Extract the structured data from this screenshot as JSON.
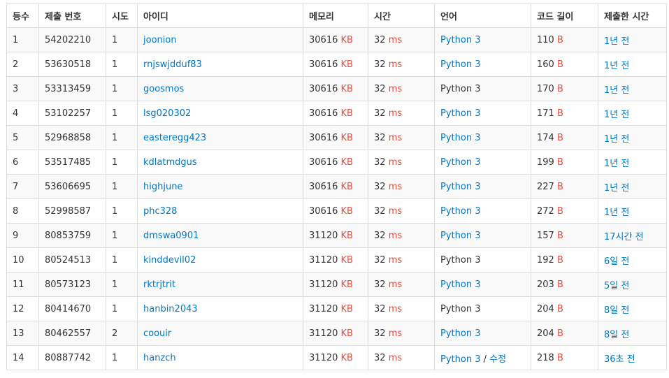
{
  "headers": [
    "등수",
    "제출 번호",
    "시도",
    "아이디",
    "메모리",
    "시간",
    "언어",
    "코드 길이",
    "제출한 시간"
  ],
  "units": {
    "memory": "KB",
    "time": "ms",
    "length": "B"
  },
  "rows": [
    {
      "rank": "1",
      "submit_id": "54202210",
      "tries": "1",
      "user": "joonion",
      "memory": "30616",
      "time": "32",
      "lang": "Python 3",
      "lang_linked": true,
      "edit": "",
      "length": "110",
      "submitted": "1년 전"
    },
    {
      "rank": "2",
      "submit_id": "53630518",
      "tries": "1",
      "user": "rnjswjdduf83",
      "memory": "30616",
      "time": "32",
      "lang": "Python 3",
      "lang_linked": true,
      "edit": "",
      "length": "160",
      "submitted": "1년 전"
    },
    {
      "rank": "3",
      "submit_id": "53313459",
      "tries": "1",
      "user": "goosmos",
      "memory": "30616",
      "time": "32",
      "lang": "Python 3",
      "lang_linked": false,
      "edit": "",
      "length": "170",
      "submitted": "1년 전"
    },
    {
      "rank": "4",
      "submit_id": "53102257",
      "tries": "1",
      "user": "lsg020302",
      "memory": "30616",
      "time": "32",
      "lang": "Python 3",
      "lang_linked": true,
      "edit": "",
      "length": "171",
      "submitted": "1년 전"
    },
    {
      "rank": "5",
      "submit_id": "52968858",
      "tries": "1",
      "user": "easteregg423",
      "memory": "30616",
      "time": "32",
      "lang": "Python 3",
      "lang_linked": true,
      "edit": "",
      "length": "174",
      "submitted": "1년 전"
    },
    {
      "rank": "6",
      "submit_id": "53517485",
      "tries": "1",
      "user": "kdlatmdgus",
      "memory": "30616",
      "time": "32",
      "lang": "Python 3",
      "lang_linked": true,
      "edit": "",
      "length": "199",
      "submitted": "1년 전"
    },
    {
      "rank": "7",
      "submit_id": "53606695",
      "tries": "1",
      "user": "highjune",
      "memory": "30616",
      "time": "32",
      "lang": "Python 3",
      "lang_linked": true,
      "edit": "",
      "length": "227",
      "submitted": "1년 전"
    },
    {
      "rank": "8",
      "submit_id": "52998587",
      "tries": "1",
      "user": "phc328",
      "memory": "30616",
      "time": "32",
      "lang": "Python 3",
      "lang_linked": true,
      "edit": "",
      "length": "272",
      "submitted": "1년 전"
    },
    {
      "rank": "9",
      "submit_id": "80853759",
      "tries": "1",
      "user": "dmswa0901",
      "memory": "31120",
      "time": "32",
      "lang": "Python 3",
      "lang_linked": true,
      "edit": "",
      "length": "157",
      "submitted": "17시간 전"
    },
    {
      "rank": "10",
      "submit_id": "80524513",
      "tries": "1",
      "user": "kinddevil02",
      "memory": "31120",
      "time": "32",
      "lang": "Python 3",
      "lang_linked": false,
      "edit": "",
      "length": "192",
      "submitted": "6일 전"
    },
    {
      "rank": "11",
      "submit_id": "80573123",
      "tries": "1",
      "user": "rktrjtrit",
      "memory": "31120",
      "time": "32",
      "lang": "Python 3",
      "lang_linked": true,
      "edit": "",
      "length": "203",
      "submitted": "5일 전"
    },
    {
      "rank": "12",
      "submit_id": "80414670",
      "tries": "1",
      "user": "hanbin2043",
      "memory": "31120",
      "time": "32",
      "lang": "Python 3",
      "lang_linked": false,
      "edit": "",
      "length": "204",
      "submitted": "8일 전"
    },
    {
      "rank": "13",
      "submit_id": "80462557",
      "tries": "2",
      "user": "coouir",
      "memory": "31120",
      "time": "32",
      "lang": "Python 3",
      "lang_linked": true,
      "edit": "",
      "length": "204",
      "submitted": "8일 전"
    },
    {
      "rank": "14",
      "submit_id": "80887742",
      "tries": "1",
      "user": "hanzch",
      "memory": "31120",
      "time": "32",
      "lang": "Python 3",
      "lang_linked": true,
      "edit": "수정",
      "length": "218",
      "submitted": "36초 전"
    }
  ],
  "colors": {
    "link": "#0076c0",
    "unit": "#e74c3c",
    "border": "#dddddd",
    "stripe": "#f9f9f9"
  }
}
